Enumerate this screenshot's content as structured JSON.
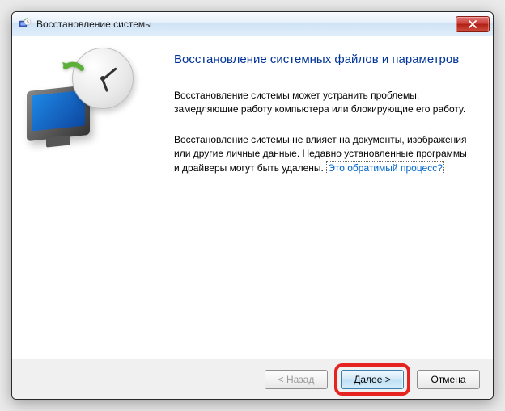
{
  "window": {
    "title": "Восстановление системы"
  },
  "content": {
    "heading": "Восстановление системных файлов и параметров",
    "para1": "Восстановление системы может устранить проблемы, замедляющие работу компьютера или блокирующие его работу.",
    "para2_before": "Восстановление системы не влияет на документы, изображения или другие личные данные. Недавно установленные программы и драйверы могут быть удалены. ",
    "para2_link": "Это обратимый процесс?"
  },
  "buttons": {
    "back": "< Назад",
    "next": "Далее >",
    "cancel": "Отмена"
  }
}
